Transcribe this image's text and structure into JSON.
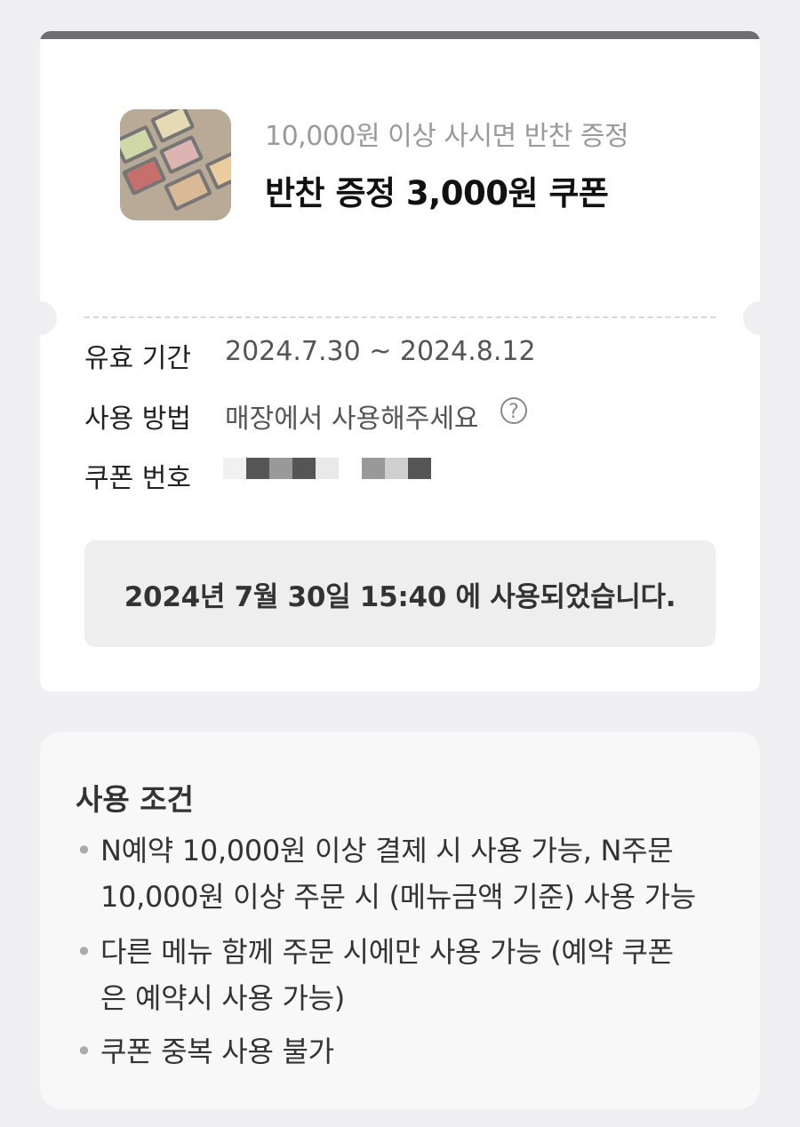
{
  "coupon": {
    "subtitle": "10,000원 이상 사시면 반찬 증정",
    "title": "반찬 증정 3,000원 쿠폰",
    "image_icon": "side-dish-photo"
  },
  "details": {
    "validity_label": "유효 기간",
    "validity_value": "2024.7.30 ~ 2024.8.12",
    "method_label": "사용 방법",
    "method_value": "매장에서 사용해주세요",
    "help_icon": "?",
    "code_label": "쿠폰 번호",
    "code_masked": true
  },
  "used_notice": "2024년 7월 30일 15:40 에 사용되었습니다.",
  "conditions": {
    "title": "사용 조건",
    "items": [
      {
        "lines": [
          "N예약 10,000원 이상 결제 시 사용 가능, N주문",
          "10,000원 이상 주문 시 (메뉴금액 기준) 사용 가능"
        ]
      },
      {
        "lines": [
          "다른 메뉴 함께 주문 시에만 사용 가능 (예약 쿠폰",
          "은 예약시 사용 가능)"
        ]
      },
      {
        "lines": [
          "쿠폰 중복 사용 불가"
        ]
      }
    ],
    "bullet": "•"
  },
  "colors": {
    "page_bg": "#efeff1",
    "card_bg": "#ffffff",
    "top_bar": "#6e6e70",
    "notice_bg": "#eeeeef"
  }
}
